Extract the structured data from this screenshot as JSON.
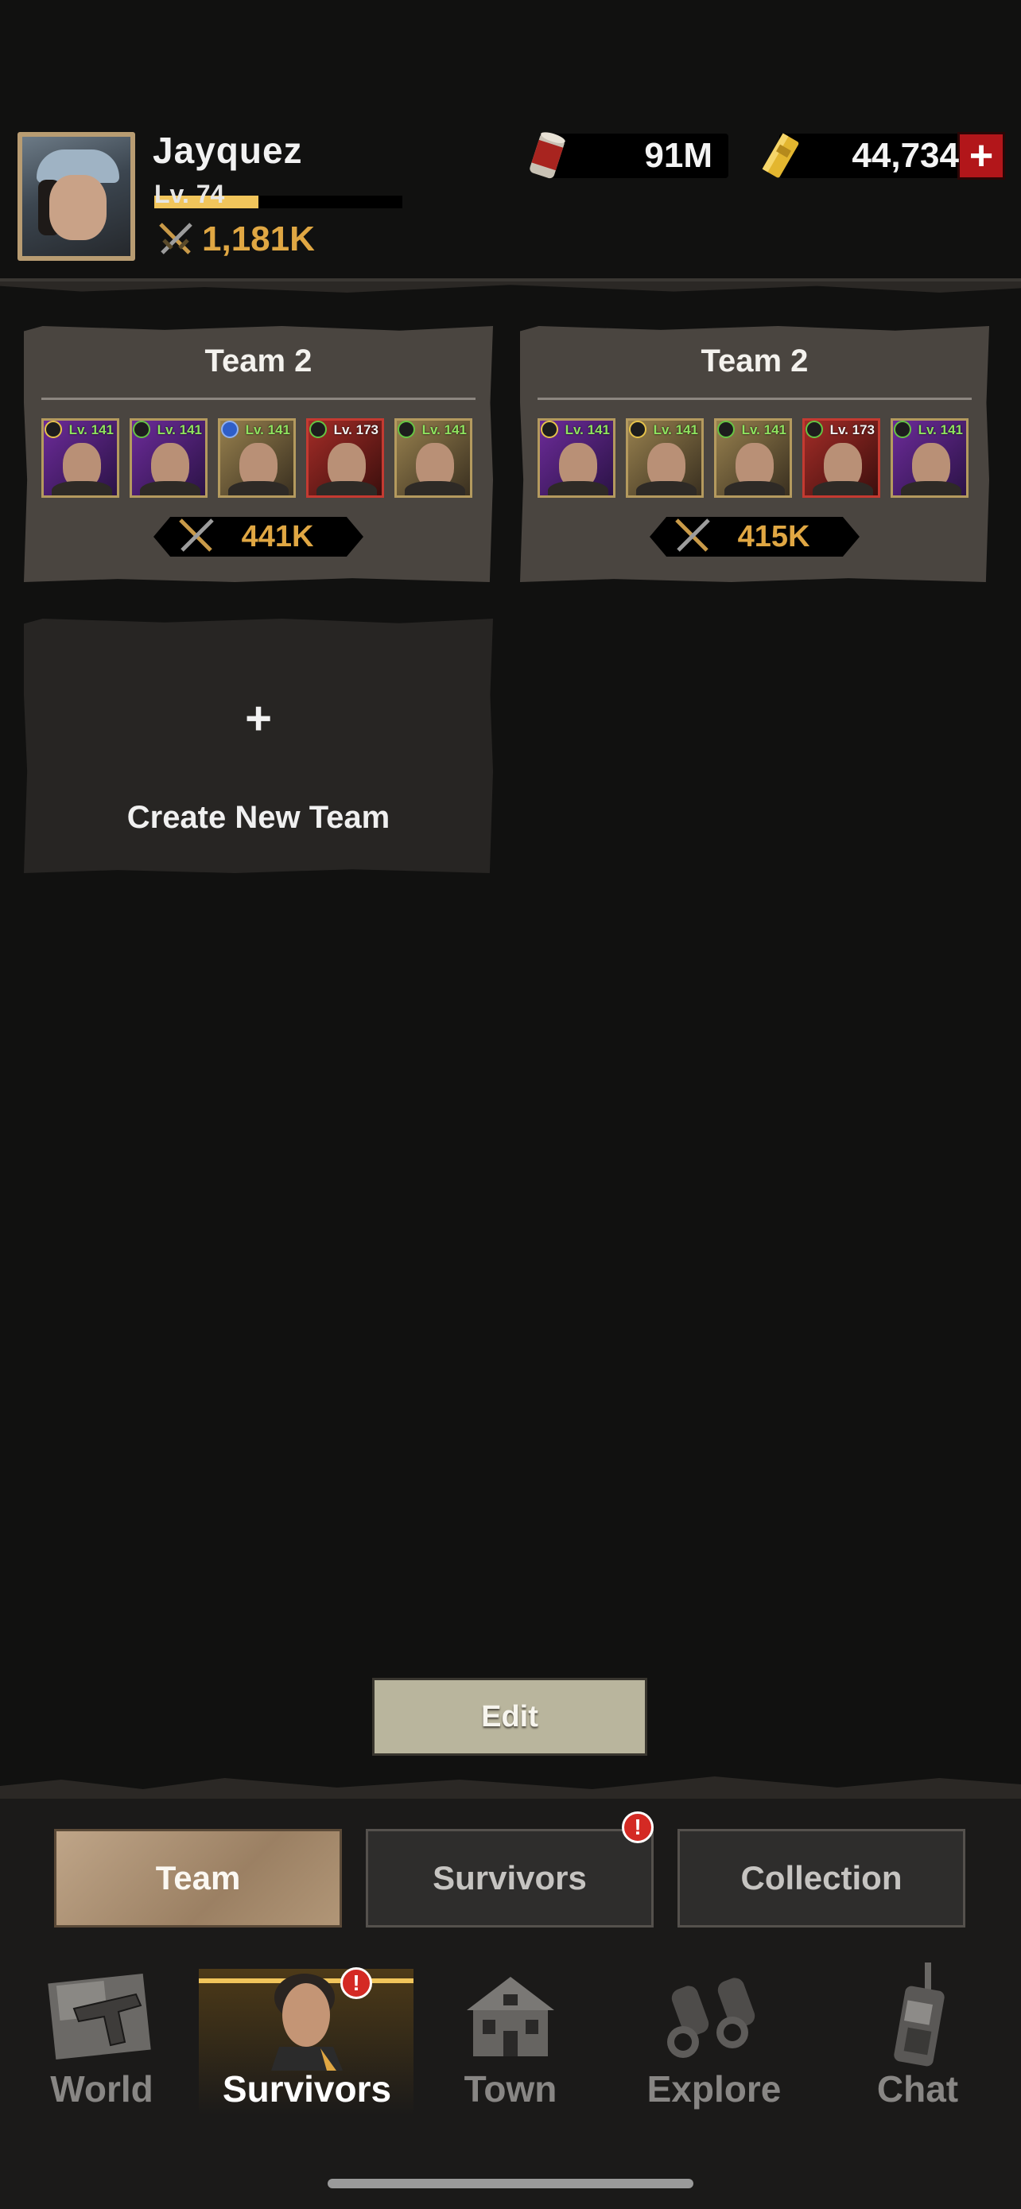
{
  "player": {
    "name": "Jayquez",
    "level_label": "Lv. 74",
    "xp_progress": 0.42,
    "power": "1,181K"
  },
  "resources": {
    "food": "91M",
    "gold": "44,734",
    "add_symbol": "+"
  },
  "teams": [
    {
      "title": "Team 2",
      "power": "441K",
      "members": [
        {
          "level": "Lv. 141",
          "frame": "purple",
          "badge": "gold"
        },
        {
          "level": "Lv. 141",
          "frame": "purple",
          "badge": "green"
        },
        {
          "level": "Lv. 141",
          "frame": "gold",
          "badge": "blue"
        },
        {
          "level": "Lv. 173",
          "frame": "red",
          "badge": "green"
        },
        {
          "level": "Lv. 141",
          "frame": "gold",
          "badge": "green"
        }
      ]
    },
    {
      "title": "Team 2",
      "power": "415K",
      "members": [
        {
          "level": "Lv. 141",
          "frame": "purple",
          "badge": "gold"
        },
        {
          "level": "Lv. 141",
          "frame": "gold",
          "badge": "gold"
        },
        {
          "level": "Lv. 141",
          "frame": "gold",
          "badge": "green"
        },
        {
          "level": "Lv. 173",
          "frame": "red",
          "badge": "green"
        },
        {
          "level": "Lv. 141",
          "frame": "purple",
          "badge": "green"
        }
      ]
    }
  ],
  "create_team": {
    "plus": "+",
    "label": "Create New Team"
  },
  "edit_label": "Edit",
  "sub_tabs": [
    {
      "label": "Team",
      "active": true
    },
    {
      "label": "Survivors",
      "active": false,
      "alert": true
    },
    {
      "label": "Collection",
      "active": false
    }
  ],
  "alert_symbol": "!",
  "nav": [
    {
      "label": "World",
      "icon": "revolver-map-icon"
    },
    {
      "label": "Survivors",
      "icon": "survivor-portrait-icon",
      "active": true,
      "alert": true
    },
    {
      "label": "Town",
      "icon": "house-icon"
    },
    {
      "label": "Explore",
      "icon": "binoculars-icon"
    },
    {
      "label": "Chat",
      "icon": "walkie-talkie-icon"
    }
  ],
  "colors": {
    "background": "#111110",
    "accent_gold": "#e0a743",
    "xp_fill": "#f1c55b",
    "alert_red": "#d42a24",
    "level_green": "#8fe35f"
  }
}
